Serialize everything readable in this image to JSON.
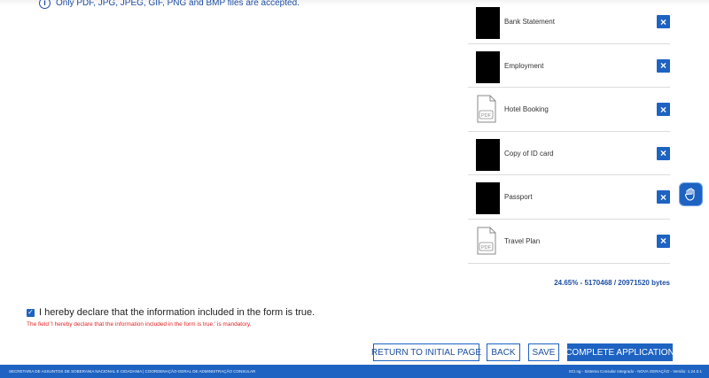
{
  "upload_note": {
    "text": "Only PDF, JPG, JPEG, GIF, PNG and BMP files are accepted."
  },
  "files": [
    {
      "name": "Bank Statement",
      "thumb": "redacted"
    },
    {
      "name": "Employment",
      "thumb": "redacted"
    },
    {
      "name": "Hotel Booking",
      "thumb": "pdf-icon"
    },
    {
      "name": "Copy of ID card",
      "thumb": "redacted"
    },
    {
      "name": "Passport",
      "thumb": "redacted"
    },
    {
      "name": "Travel Plan",
      "thumb": "pdf-icon"
    }
  ],
  "remove_glyph": "×",
  "storage_usage": "24.65% - 5170468 / 20971520 bytes",
  "declaration": {
    "checked": true,
    "label": "I hereby declare that the information included in the form is true.",
    "error": "The field 'I hereby declare that the information included in the form is true.' is mandatory."
  },
  "buttons": {
    "return": "RETURN TO INITIAL PAGE",
    "back": "BACK",
    "save": "SAVE",
    "complete": "COMPLETE APPLICATION"
  },
  "footer": {
    "left": "SECRETARIA DE ASSUNTOS DE SOBERANIA NACIONAL E CIDADANIA | COORDENAÇÃO-GERAL DE ADMINISTRAÇÃO CONSULAR",
    "right": "SCI.ng - Sistema Consular Integrado - NOVA GERAÇÃO - Versão: 1.24.0.1"
  },
  "colors": {
    "primary": "#1e63c2",
    "error": "#e02424",
    "link_text": "#1c4fa0"
  },
  "icons": {
    "info": "info-icon",
    "remove": "close-icon",
    "pdf": "pdf-file-icon",
    "accessibility": "hand-sign-icon",
    "checkbox": "checkmark-icon"
  }
}
